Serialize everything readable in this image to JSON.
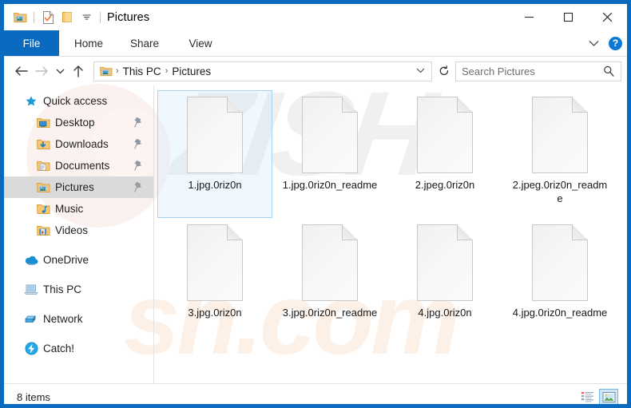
{
  "window": {
    "title": "Pictures",
    "quick_access_toolbar": [
      {
        "name": "pictures-folder-icon",
        "label": "Pictures folder"
      },
      {
        "name": "properties-icon",
        "label": "Properties"
      },
      {
        "name": "new-folder-icon",
        "label": "New folder"
      },
      {
        "name": "customize-chevron-icon",
        "label": "Customize Quick Access Toolbar"
      }
    ],
    "controls": {
      "minimize": "–",
      "maximize": "☐",
      "close": "✕"
    },
    "border_color": "#0a6ac0"
  },
  "ribbon": {
    "tabs": [
      {
        "label": "File",
        "active": true
      },
      {
        "label": "Home",
        "active": false
      },
      {
        "label": "Share",
        "active": false
      },
      {
        "label": "View",
        "active": false
      }
    ],
    "expand_icon": "chevron-down-icon",
    "help_label": "?"
  },
  "address_bar": {
    "back_icon": "←",
    "forward_icon": "→",
    "recent_icon": "⌄",
    "up_icon": "↑",
    "breadcrumb": [
      "This PC",
      "Pictures"
    ],
    "breadcrumb_separator": "›",
    "dropdown_icon": "⌄",
    "refresh_icon": "↻",
    "search_placeholder": "Search Pictures",
    "search_value": ""
  },
  "sidebar": {
    "groups": [
      {
        "items": [
          {
            "label": "Quick access",
            "icon": "star-icon",
            "level": 0,
            "pinned": false,
            "selected": false
          },
          {
            "label": "Desktop",
            "icon": "desktop-folder-icon",
            "level": 1,
            "pinned": true,
            "selected": false
          },
          {
            "label": "Downloads",
            "icon": "downloads-folder-icon",
            "level": 1,
            "pinned": true,
            "selected": false
          },
          {
            "label": "Documents",
            "icon": "documents-folder-icon",
            "level": 1,
            "pinned": true,
            "selected": false
          },
          {
            "label": "Pictures",
            "icon": "pictures-folder-icon",
            "level": 1,
            "pinned": true,
            "selected": true
          },
          {
            "label": "Music",
            "icon": "music-folder-icon",
            "level": 1,
            "pinned": false,
            "selected": false
          },
          {
            "label": "Videos",
            "icon": "videos-folder-icon",
            "level": 1,
            "pinned": false,
            "selected": false
          }
        ]
      },
      {
        "items": [
          {
            "label": "OneDrive",
            "icon": "onedrive-cloud-icon",
            "level": 0,
            "pinned": false,
            "selected": false
          }
        ]
      },
      {
        "items": [
          {
            "label": "This PC",
            "icon": "this-pc-icon",
            "level": 0,
            "pinned": false,
            "selected": false
          }
        ]
      },
      {
        "items": [
          {
            "label": "Network",
            "icon": "network-icon",
            "level": 0,
            "pinned": false,
            "selected": false
          }
        ]
      },
      {
        "items": [
          {
            "label": "Catch!",
            "icon": "catch-icon",
            "level": 0,
            "pinned": false,
            "selected": false
          }
        ]
      }
    ]
  },
  "content": {
    "files": [
      {
        "name": "1.jpg.0riz0n",
        "icon": "blank-document-icon",
        "selected": true
      },
      {
        "name": "1.jpg.0riz0n_readme",
        "icon": "blank-document-icon",
        "selected": false
      },
      {
        "name": "2.jpeg.0riz0n",
        "icon": "blank-document-icon",
        "selected": false
      },
      {
        "name": "2.jpeg.0riz0n_readme",
        "icon": "blank-document-icon",
        "selected": false
      },
      {
        "name": "3.jpg.0riz0n",
        "icon": "blank-document-icon",
        "selected": false
      },
      {
        "name": "3.jpg.0riz0n_readme",
        "icon": "blank-document-icon",
        "selected": false
      },
      {
        "name": "4.jpg.0riz0n",
        "icon": "blank-document-icon",
        "selected": false
      },
      {
        "name": "4.jpg.0riz0n_readme",
        "icon": "blank-document-icon",
        "selected": false
      }
    ]
  },
  "status_bar": {
    "item_count_text": "8 items",
    "views": [
      {
        "name": "details-view-button",
        "active": false
      },
      {
        "name": "large-icons-view-button",
        "active": true
      }
    ]
  },
  "watermark": {
    "top_text": "ZISH",
    "bottom_text": "sh.com"
  }
}
